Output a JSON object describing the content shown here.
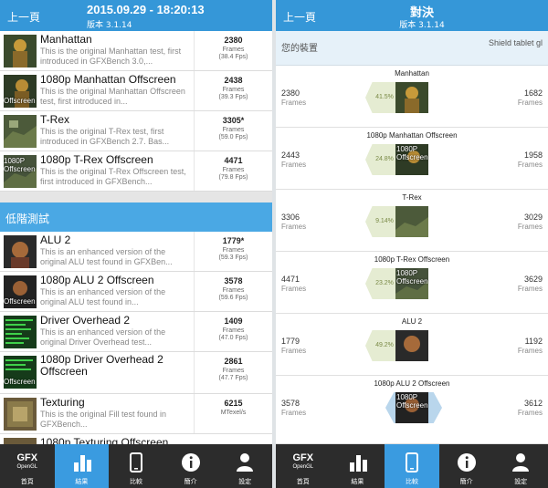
{
  "left": {
    "back_label": "上一頁",
    "title": "2015.09.29 - 18:20:13",
    "version": "版本 3.1.14",
    "section_label": "低階測試",
    "tests": [
      {
        "name": "Manhattan",
        "desc": "This is the original Manhattan test, first introduced in GFXBench 3.0,...",
        "score": "2380",
        "unit": "Frames",
        "fps": "(38.4 Fps)",
        "overlay": ""
      },
      {
        "name": "1080p Manhattan Offscreen",
        "desc": "This is the original Manhattan Offscreen test, first introduced in...",
        "score": "2438",
        "unit": "Frames",
        "fps": "(39.3 Fps)",
        "overlay": "Offscreen"
      },
      {
        "name": "T-Rex",
        "desc": "This is the original T-Rex test, first introduced in GFXBench 2.7. Bas...",
        "score": "3305*",
        "unit": "Frames",
        "fps": "(59.0 Fps)",
        "overlay": ""
      },
      {
        "name": "1080p T-Rex Offscreen",
        "desc": "This is the original T-Rex Offscreen test, first introduced in GFXBench...",
        "score": "4471",
        "unit": "Frames",
        "fps": "(79.8 Fps)",
        "overlay": "1080P Offscreen"
      },
      {
        "name": "ALU 2",
        "desc": "This is an enhanced version of the original ALU test found in GFXBen...",
        "score": "1779*",
        "unit": "Frames",
        "fps": "(59.3 Fps)",
        "overlay": ""
      },
      {
        "name": "1080p ALU 2 Offscreen",
        "desc": "This is an enhanced version of the original ALU test found in...",
        "score": "3578",
        "unit": "Frames",
        "fps": "(59.6 Fps)",
        "overlay": "Offscreen"
      },
      {
        "name": "Driver Overhead 2",
        "desc": "This is an enhanced version of the original Driver Overhead test...",
        "score": "1409",
        "unit": "Frames",
        "fps": "(47.0 Fps)",
        "overlay": ""
      },
      {
        "name": "1080p Driver Overhead 2 Offscreen",
        "desc": "",
        "score": "2861",
        "unit": "Frames",
        "fps": "(47.7 Fps)",
        "overlay": "Offscreen"
      },
      {
        "name": "Texturing",
        "desc": "This is the original Fill test found in GFXBench...",
        "score": "6215",
        "unit": "MTexel/s",
        "fps": "",
        "overlay": ""
      },
      {
        "name": "1080p Texturing Offscreen",
        "desc": "",
        "score": "",
        "unit": "",
        "fps": "",
        "overlay": ""
      }
    ]
  },
  "right": {
    "back_label": "上一頁",
    "title": "對決",
    "version": "版本 3.1.14",
    "my_device_label": "您的裝置",
    "other_device_label": "Shield tablet gl",
    "comparisons": [
      {
        "name": "Manhattan",
        "left_score": "2380",
        "left_unit": "Frames",
        "percent": "41.5%",
        "right_score": "1682",
        "right_unit": "Frames",
        "overlay": ""
      },
      {
        "name": "1080p Manhattan Offscreen",
        "left_score": "2443",
        "left_unit": "Frames",
        "percent": "24.8%",
        "right_score": "1958",
        "right_unit": "Frames",
        "overlay": "1080P Offscreen"
      },
      {
        "name": "T-Rex",
        "left_score": "3306",
        "left_unit": "Frames",
        "percent": "9.14%",
        "right_score": "3029",
        "right_unit": "Frames",
        "overlay": ""
      },
      {
        "name": "1080p T-Rex Offscreen",
        "left_score": "4471",
        "left_unit": "Frames",
        "percent": "23.2%",
        "right_score": "3629",
        "right_unit": "Frames",
        "overlay": "1080P Offscreen"
      },
      {
        "name": "ALU 2",
        "left_score": "1779",
        "left_unit": "Frames",
        "percent": "49.2%",
        "right_score": "1192",
        "right_unit": "Frames",
        "overlay": ""
      },
      {
        "name": "1080p ALU 2 Offscreen",
        "left_score": "3578",
        "left_unit": "Frames",
        "percent": "",
        "right_score": "3612",
        "right_unit": "Frames",
        "overlay": "1080P Offscreen"
      }
    ]
  },
  "tabs": [
    {
      "label": "首頁",
      "icon": "gfx-logo-icon",
      "logo_top": "GFX",
      "logo_sub": "OpenGL"
    },
    {
      "label": "結果",
      "icon": "bar-chart-icon"
    },
    {
      "label": "比較",
      "icon": "phone-icon"
    },
    {
      "label": "簡介",
      "icon": "info-icon"
    },
    {
      "label": "設定",
      "icon": "user-icon"
    }
  ],
  "left_active_tab": 1,
  "right_active_tab": 2,
  "colors": {
    "header": "#3597d8",
    "active_tab": "#3a9be0",
    "tab_bar": "#2c2c2c",
    "section": "#4aa8e4"
  }
}
